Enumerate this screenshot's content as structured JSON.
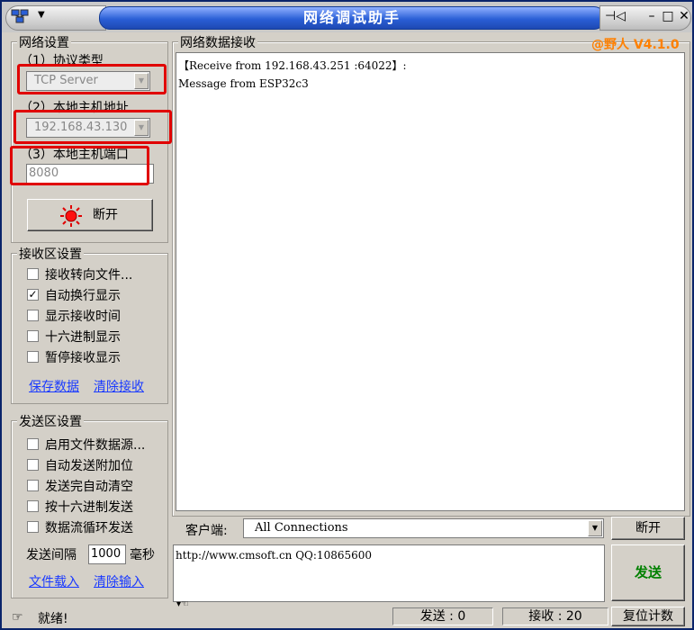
{
  "window": {
    "title": "网络调试助手",
    "version": "@野人 V4.1.0"
  },
  "network_settings": {
    "title": "网络设置",
    "protocol_label": "（1）协议类型",
    "protocol_value": "TCP Server",
    "host_label": "（2）本地主机地址",
    "host_value": "192.168.43.130",
    "port_label": "（3）本地主机端口",
    "port_value": "8080",
    "connect_button": "断开"
  },
  "receive_settings": {
    "title": "接收区设置",
    "options": [
      {
        "label": "接收转向文件...",
        "checked": false
      },
      {
        "label": "自动换行显示",
        "checked": true
      },
      {
        "label": "显示接收时间",
        "checked": false
      },
      {
        "label": "十六进制显示",
        "checked": false
      },
      {
        "label": "暂停接收显示",
        "checked": false
      }
    ],
    "save_link": "保存数据",
    "clear_link": "清除接收"
  },
  "send_settings": {
    "title": "发送区设置",
    "options": [
      {
        "label": "启用文件数据源...",
        "checked": false
      },
      {
        "label": "自动发送附加位",
        "checked": false
      },
      {
        "label": "发送完自动清空",
        "checked": false
      },
      {
        "label": "按十六进制发送",
        "checked": false
      },
      {
        "label": "数据流循环发送",
        "checked": false
      }
    ],
    "interval_label": "发送间隔",
    "interval_value": "1000",
    "interval_unit": "毫秒",
    "load_link": "文件载入",
    "clear_link": "清除输入"
  },
  "receive_area": {
    "title": "网络数据接收",
    "lines": [
      "【Receive from 192.168.43.251 :64022】:",
      "Message from ESP32c3"
    ]
  },
  "client": {
    "label": "客户端:",
    "value": "All Connections",
    "disconnect_button": "断开"
  },
  "send_area": {
    "text": "http://www.cmsoft.cn QQ:10865600",
    "send_button": "发送"
  },
  "status": {
    "ready": "就绪!",
    "sent": "发送 : 0",
    "received": "接收 : 20",
    "reset_button": "复位计数"
  },
  "colors": {
    "accent_orange": "#ff8000",
    "send_green": "#008000",
    "red_mark": "#e00000",
    "link_blue": "#1a3aff"
  }
}
